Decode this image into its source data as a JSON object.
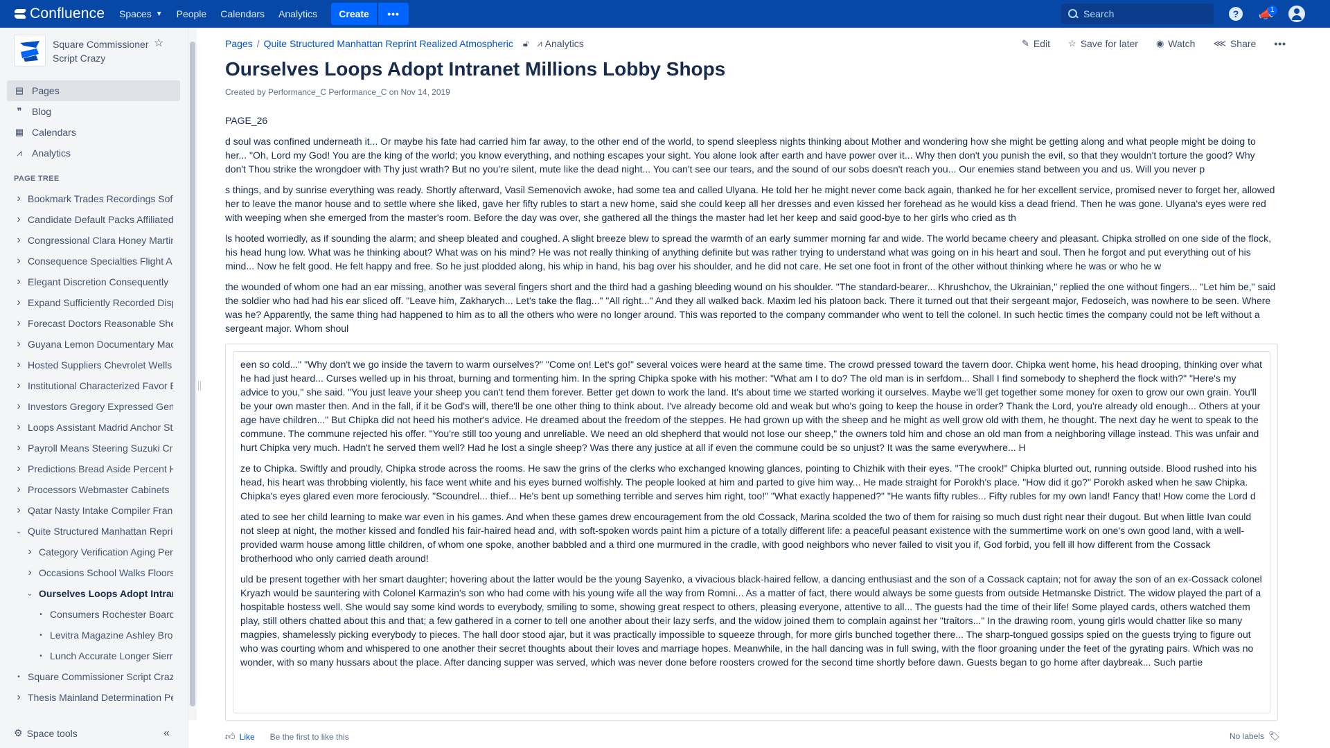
{
  "topnav": {
    "logo_text": "Confluence",
    "spaces": "Spaces",
    "people": "People",
    "calendars": "Calendars",
    "analytics": "Analytics",
    "create": "Create",
    "more": "•••",
    "search_placeholder": "Search",
    "help": "?",
    "notif_count": "1"
  },
  "sidebar": {
    "space_name": "Square Commissioner Script Crazy",
    "nav": [
      {
        "label": "Pages",
        "icon": "page-icon"
      },
      {
        "label": "Blog",
        "icon": "quote-icon"
      },
      {
        "label": "Calendars",
        "icon": "calendar-icon"
      },
      {
        "label": "Analytics",
        "icon": "analytics-icon"
      }
    ],
    "page_tree_label": "PAGE TREE",
    "tree": [
      {
        "label": "Bookmark Trades Recordings Software",
        "level": 0,
        "chev": "›"
      },
      {
        "label": "Candidate Default Packs Affiliated",
        "level": 0,
        "chev": "›"
      },
      {
        "label": "Congressional Clara Honey Martin",
        "level": 0,
        "chev": "›"
      },
      {
        "label": "Consequence Specialties Flight A",
        "level": 0,
        "chev": "›"
      },
      {
        "label": "Elegant Discretion Consequently",
        "level": 0,
        "chev": "›"
      },
      {
        "label": "Expand Sufficiently Recorded Disp",
        "level": 0,
        "chev": "›"
      },
      {
        "label": "Forecast Doctors Reasonable She",
        "level": 0,
        "chev": "›"
      },
      {
        "label": "Guyana Lemon Documentary Mac",
        "level": 0,
        "chev": "›"
      },
      {
        "label": "Hosted Suppliers Chevrolet Wells",
        "level": 0,
        "chev": "›"
      },
      {
        "label": "Institutional Characterized Favor E",
        "level": 0,
        "chev": "›"
      },
      {
        "label": "Investors Gregory Expressed Gen",
        "level": 0,
        "chev": "›"
      },
      {
        "label": "Loops Assistant Madrid Anchor St",
        "level": 0,
        "chev": "›"
      },
      {
        "label": "Payroll Means Steering Suzuki Cr",
        "level": 0,
        "chev": "›"
      },
      {
        "label": "Predictions Bread Aside Percent H",
        "level": 0,
        "chev": "›"
      },
      {
        "label": "Processors Webmaster Cabinets",
        "level": 0,
        "chev": "›"
      },
      {
        "label": "Qatar Nasty Intake Compiler Fran",
        "level": 0,
        "chev": "›"
      },
      {
        "label": "Quite Structured Manhattan Repri",
        "level": 0,
        "chev": "⌄"
      },
      {
        "label": "Category Verification Aging Peri",
        "level": 1,
        "chev": "›"
      },
      {
        "label": "Occasions School Walks Floors",
        "level": 1,
        "chev": "›"
      },
      {
        "label": "Ourselves Loops Adopt Intran",
        "level": 1,
        "chev": "⌄"
      },
      {
        "label": "Consumers Rochester Boards",
        "level": 2,
        "chev": "•"
      },
      {
        "label": "Levitra Magazine Ashley Brok",
        "level": 2,
        "chev": "•"
      },
      {
        "label": "Lunch Accurate Longer Sierra",
        "level": 2,
        "chev": "•"
      },
      {
        "label": "Square Commissioner Script Craz",
        "level": 0,
        "chev": "•"
      },
      {
        "label": "Thesis Mainland Determination Pe",
        "level": 0,
        "chev": "›"
      }
    ],
    "space_tools": "Space tools"
  },
  "breadcrumb": {
    "pages": "Pages",
    "sep": "/",
    "parent": "Quite Structured Manhattan Reprint Realized Atmospheric",
    "analytics": "Analytics"
  },
  "actions": {
    "edit": "Edit",
    "save_for_later": "Save for later",
    "watch": "Watch",
    "share": "Share",
    "more": "•••"
  },
  "page": {
    "title": "Ourselves Loops Adopt Intranet Millions Lobby Shops",
    "byline": "Created by Performance_C Performance_C on Nov 14, 2019",
    "page_id": "PAGE_26",
    "paragraphs": [
      "d soul was confined underneath it... Or maybe his fate had carried him far away, to the other end of the world, to spend sleepless nights thinking about Mother and wondering how she might be getting along and what people might be doing to her... \"Oh, Lord my God! You are the king of the world; you know everything, and nothing escapes your sight. You alone look after earth and have power over it... Why then don't you punish the evil, so that they wouldn't torture the good? Why don't Thou strike the wrongdoer with Thy just wrath? But no you're silent, mute like the dead night... You can't see our tears, and the sound of our sobs doesn't reach you... Our enemies stand between you and us. Will you never p",
      "s things, and by sunrise everything was ready. Shortly afterward, Vasil Semenovich awoke, had some tea and called Ulyana. He told her he might never come back again, thanked he for her excellent service, promised never to forget her, allowed her to leave the manor house and to settle where she liked, gave her fifty rubles to start a new home, said she could keep all her dresses and even kissed her forehead as he would kiss a dead friend. Then he was gone. Ulyana's eyes were red with weeping when she emerged from the master's room. Before the day was over, she gathered all the things the master had let her keep and said good-bye to her girls who cried as th",
      "ls hooted worriedly, as if sounding the alarm; and sheep bleated and coughed. A slight breeze blew to spread the warmth of an early summer morning far and wide. The world became cheery and pleasant. Chipka strolled on one side of the flock, his head hung low. What was he thinking about? What was on his mind? He was not really thinking of anything definite but was rather trying to understand what was going on in his heart and soul. Then he forgot and put everything out of his mind... Now he felt good. He felt happy and free. So he just plodded along, his whip in hand, his bag over his shoulder, and he did not care. He set one foot in front of the other without thinking where he was or who he w",
      "the wounded of whom one had an ear missing, another was several fingers short and the third had a gashing bleeding wound on his shoulder. \"The standard-bearer... Khrushchov, the Ukrainian,\" replied the one without fingers... \"Let him be,\" said the soldier who had had his ear sliced off. \"Leave him, Zakharych... Let's take the flag...\" \"All right...\" And they all walked back. Maxim led his platoon back. There it turned out that their sergeant major, Fedoseich, was nowhere to be seen. Where was he? Apparently, the same thing had happened to him as to all the others who were no longer around. This was reported to the company commander who went to tell the colonel. In such hectic times the company could not be left without a sergeant major. Whom shoul"
    ],
    "panel_paragraphs": [
      "een so cold...\" \"Why don't we go inside the tavern to warm ourselves?\" \"Come on! Let's go!\" several voices were heard at the same time. The crowd pressed toward the tavern door. Chipka went home, his head drooping, thinking over what he had just heard... Curses welled up in his throat, burning and tormenting him. In the spring Chipka spoke with his mother: \"What am I to do? The old man is in serfdom... Shall I find somebody to shepherd the flock with?\" \"Here's my advice to you,\" she said. \"You just leave your sheep you can't tend them forever. Better get down to work the land. It's about time we started working it ourselves. Maybe we'll get together some money for oxen to grow our own grain. You'll be your own master then. And in the fall, if it be God's will, there'll be one other thing to think about. I've already become old and weak but who's going to keep the house in order? Thank the Lord, you're already old enough... Others at your age have children...\" But Chipka did not heed his mother's advice. He dreamed about the freedom of the steppes. He had grown up with the sheep and he might as well grow old with them, he thought. The next day he went to speak to the commune. The commune rejected his offer. \"You're still too young and unreliable. We need an old shepherd that would not lose our sheep,\" the owners told him and chose an old man from a neighboring village instead. This was unfair and hurt Chipka very much. Hadn't he served them well? Had he lost a single sheep? Was there any justice at all if even the commune could be so unjust? It was the same everywhere... H",
      "ze to Chipka. Swiftly and proudly, Chipka strode across the rooms. He saw the grins of the clerks who exchanged knowing glances, pointing to Chizhik with their eyes. \"The crook!\" Chipka blurted out, running outside. Blood rushed into his head, his heart was throbbing violently, his face went white and his eyes burned wolfishly. The people looked at him and parted to give him way... He made straight for Porokh's place. \"How did it go?\" Porokh asked when he saw Chipka. Chipka's eyes glared even more ferociously. \"Scoundrel... thief... He's bent up something terrible and serves him right, too!\" \"What exactly happened?\" \"He wants fifty rubles... Fifty rubles for my own land! Fancy that! How come the Lord d",
      "ated to see her child learning to make war even in his games. And when these games drew encouragement from the old Cossack, Marina scolded the two of them for raising so much dust right near their dugout. But when little Ivan could not sleep at night, the mother kissed and fondled his fair-haired head and, with soft-spoken words paint him a picture of a totally different life: a peaceful peasant existence with the summertime work on one's own good land, with a well-provided warm house among little children, of whom one spoke, another babbled and a third one murmured in the cradle, with good neighbors who never failed to visit you if, God forbid, you fell ill how different from the Cossack brotherhood who only carried death around!",
      "uld be present together with her smart daughter; hovering about the latter would be the young Sayenko, a vivacious black-haired fellow, a dancing enthusiast and the son of a Cossack captain; not for away the son of an ex-Cossack colonel Kryazh would be sauntering with Colonel Karmazin's son who had come with his young wife all the way from Romni... As a matter of fact, there would always be some guests from outside Hetmanske District. The widow played the part of a hospitable hostess well. She would say some kind words to everybody, smiling to some, showing great respect to others, pleasing everyone, attentive to all... The guests had the time of their life! Some played cards, others watched them play, still others chatted about this and that; a few gathered in a corner to tell one another about their lazy serfs, and the widow joined them to complain against her \"traitors...\" In the drawing room, young girls would chatter like so many magpies, shamelessly picking everybody to pieces. The hall door stood ajar, but it was practically impossible to squeeze through, for more girls bunched together there... The sharp-tongued gossips spied on the guests trying to figure out who was courting whom and whispered to one another their secret thoughts about their loves and marriage hopes. Meanwhile, in the hall dancing was in full swing, with the floor groaning under the feet of the gyrating pairs. Which was no wonder, with so many hussars about the place. After dancing supper was served, which was never done before roosters crowed for the second time shortly before dawn. Guests began to go home after daybreak... Such partie"
    ]
  },
  "footer": {
    "like": "Like",
    "first_to_like": "Be the first to like this",
    "no_labels": "No labels"
  },
  "colors": {
    "nav_bg": "#0747A6",
    "create_bg": "#0065FF",
    "link": "#0052CC",
    "sidebar_bg": "#F4F5F7"
  }
}
